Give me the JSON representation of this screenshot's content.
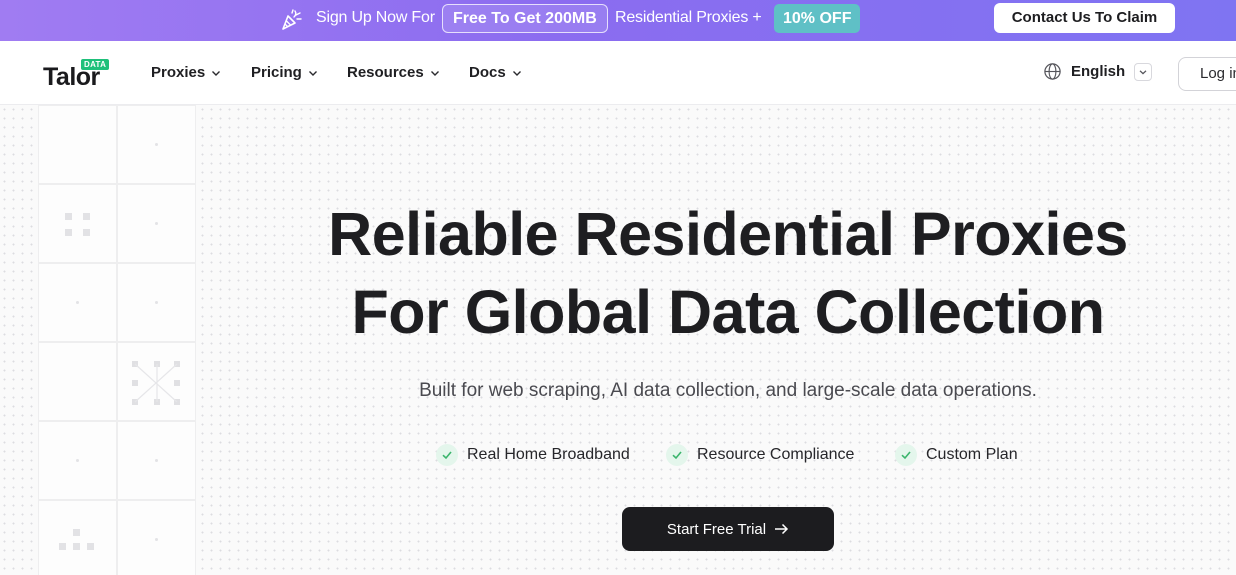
{
  "promo": {
    "text_before": "Sign Up Now For",
    "highlight": "Free To Get 200MB",
    "text_after": "Residential Proxies +",
    "badge": "10% OFF",
    "cta": "Contact Us To Claim",
    "icon": "party-popper-icon",
    "gradient_start": "#a07cf2",
    "gradient_end": "#7f74f2",
    "badge_color": "#5fc0c6"
  },
  "nav": {
    "logo_word": "Talor",
    "logo_badge": "DATA",
    "logo_badge_color": "#1ec07a",
    "menu": [
      {
        "label": "Proxies"
      },
      {
        "label": "Pricing"
      },
      {
        "label": "Resources"
      },
      {
        "label": "Docs"
      }
    ],
    "language": "English",
    "login": "Log in"
  },
  "hero": {
    "title_line1": "Reliable Residential Proxies",
    "title_line2": "For Global Data Collection",
    "subtitle": "Built for web scraping, AI data collection, and large-scale data operations.",
    "features": [
      {
        "label": "Real Home Broadband"
      },
      {
        "label": "Resource Compliance"
      },
      {
        "label": "Custom Plan"
      }
    ],
    "cta": "Start Free Trial",
    "check_color": "#3bb56c"
  }
}
